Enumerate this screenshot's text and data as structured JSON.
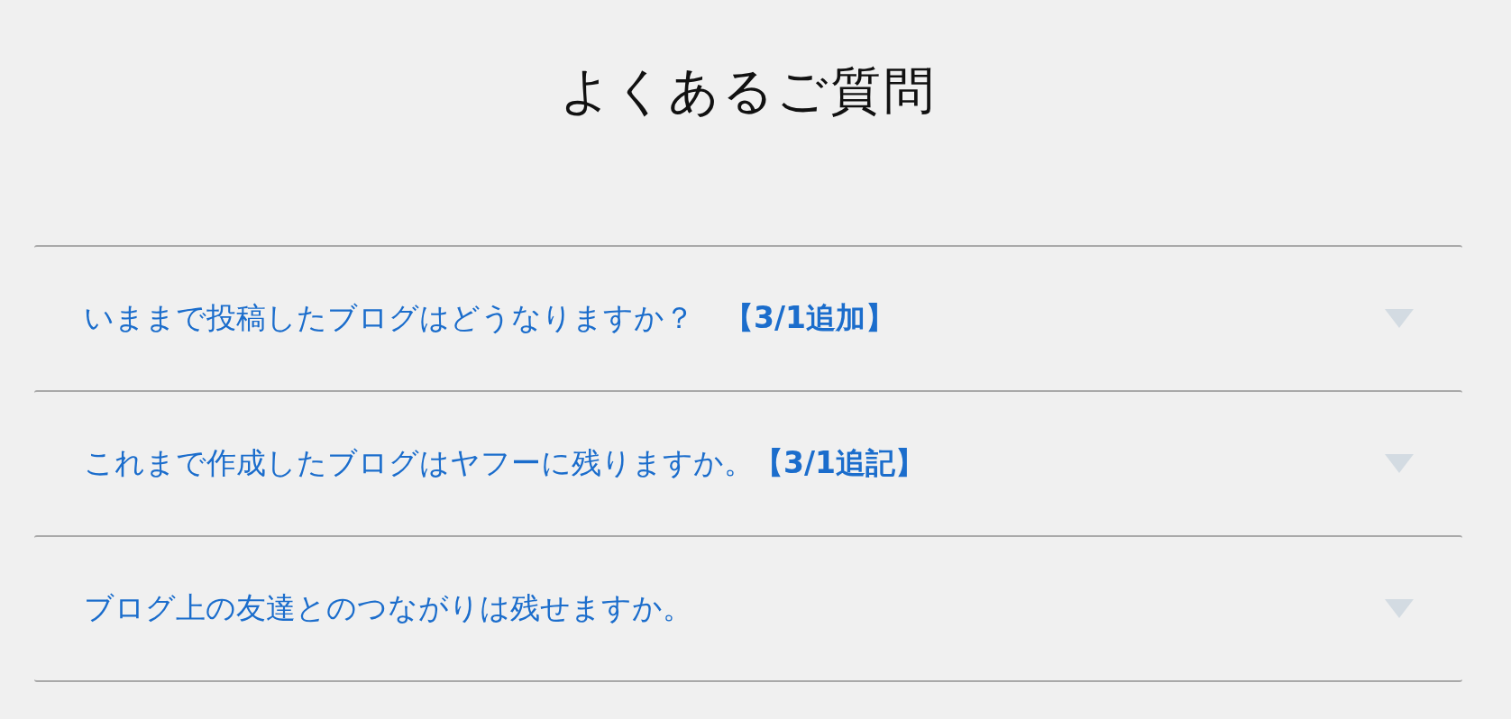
{
  "title": "よくあるご質問",
  "questions": [
    {
      "text": "いままで投稿したブログはどうなりますか？　**【3/1追加】**",
      "expanded": false
    },
    {
      "text": "これまで作成したブログはヤフーに残りますか。**【3/1追記】**",
      "expanded": false
    },
    {
      "text": "ブログ上の友達とのつながりは残せますか。",
      "expanded": false
    }
  ]
}
